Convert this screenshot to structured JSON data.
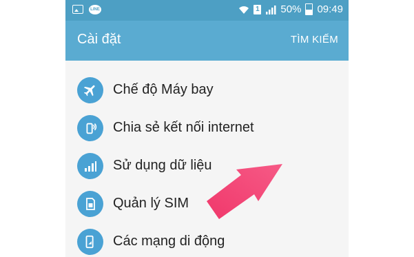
{
  "status_bar": {
    "line_badge": "LINE",
    "sim_number": "1",
    "battery": "50%",
    "time": "09:49"
  },
  "app_bar": {
    "title": "Cài đặt",
    "search_label": "TÌM KIẾM"
  },
  "settings": {
    "items": [
      {
        "label": "Chế độ Máy bay",
        "icon": "airplane-icon"
      },
      {
        "label": "Chia sẻ kết nối internet",
        "icon": "hotspot-icon"
      },
      {
        "label": "Sử dụng dữ liệu",
        "icon": "data-usage-icon"
      },
      {
        "label": "Quản lý SIM",
        "icon": "sim-card-icon"
      },
      {
        "label": "Các mạng di động",
        "icon": "mobile-network-icon"
      }
    ]
  },
  "colors": {
    "status_bar": "#4d9fc4",
    "app_bar": "#5aabd1",
    "icon_circle": "#4aa2d4",
    "arrow": "#f0386b"
  }
}
